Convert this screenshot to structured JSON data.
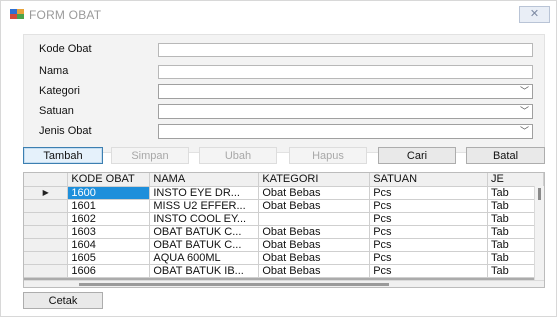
{
  "window": {
    "title": "FORM OBAT",
    "close_glyph": "✕"
  },
  "icons": {
    "app": "form-window-icon",
    "close": "close-icon",
    "row_pointer": "row-pointer-icon",
    "dropdown": "chevron-down-icon"
  },
  "form": {
    "fields": [
      {
        "label": "Kode Obat",
        "value": ""
      },
      {
        "label": "Nama",
        "value": ""
      },
      {
        "label": "Kategori",
        "value": ""
      },
      {
        "label": "Satuan",
        "value": ""
      },
      {
        "label": "Jenis Obat",
        "value": ""
      }
    ],
    "dropdown_arrow": "﹀"
  },
  "buttons": {
    "tambah": "Tambah",
    "simpan": "Simpan",
    "ubah": "Ubah",
    "hapus": "Hapus",
    "cari": "Cari",
    "batal": "Batal",
    "cetak": "Cetak"
  },
  "grid": {
    "row_pointer_glyph": "▶",
    "columns": [
      "KODE OBAT",
      "NAMA",
      "KATEGORI",
      "SATUAN",
      "JE"
    ],
    "rows": [
      [
        "1600",
        "INSTO EYE DR...",
        "Obat Bebas",
        "Pcs",
        "Tab"
      ],
      [
        "1601",
        "MISS U2 EFFER...",
        "Obat Bebas",
        "Pcs",
        "Tab"
      ],
      [
        "1602",
        "INSTO COOL EY...",
        "",
        "Pcs",
        "Tab"
      ],
      [
        "1603",
        "OBAT BATUK C...",
        "Obat Bebas",
        "Pcs",
        "Tab"
      ],
      [
        "1604",
        "OBAT BATUK C...",
        "Obat Bebas",
        "Pcs",
        "Tab"
      ],
      [
        "1605",
        "AQUA 600ML",
        "Obat Bebas",
        "Pcs",
        "Tab"
      ],
      [
        "1606",
        "OBAT BATUK IB...",
        "Obat Bebas",
        "Pcs",
        "Tab"
      ]
    ],
    "selected_row": 0
  },
  "colors": {
    "selection": "#1e8fdb",
    "group_background": "#f3f3f3",
    "grid_background": "#ababab"
  }
}
